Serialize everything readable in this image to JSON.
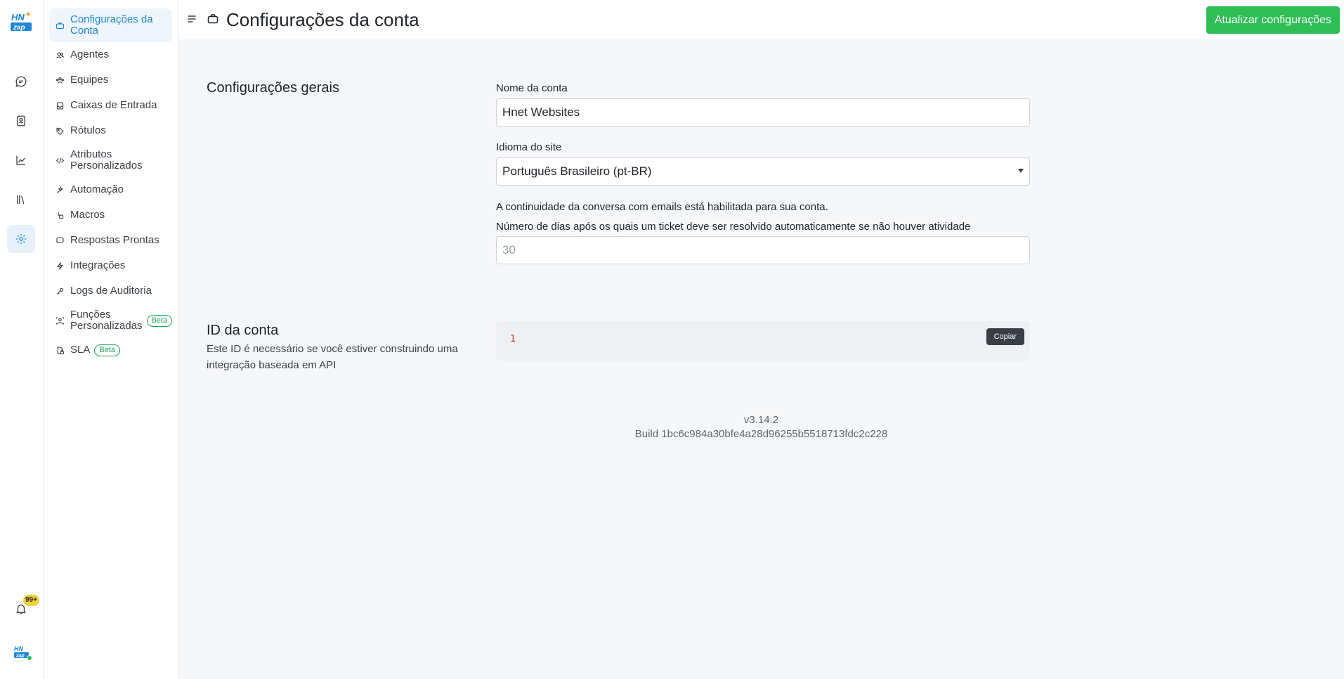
{
  "rail": {
    "items": [
      {
        "icon": "chat-icon"
      },
      {
        "icon": "contacts-icon"
      },
      {
        "icon": "reports-icon"
      },
      {
        "icon": "library-icon"
      },
      {
        "icon": "settings-icon",
        "active": true
      }
    ],
    "notifications_badge": "99+"
  },
  "sidebar": {
    "items": [
      {
        "label": "Configurações da Conta",
        "icon": "briefcase-icon",
        "active": true
      },
      {
        "label": "Agentes",
        "icon": "people-icon"
      },
      {
        "label": "Equipes",
        "icon": "team-icon"
      },
      {
        "label": "Caixas de Entrada",
        "icon": "inbox-icon"
      },
      {
        "label": "Rótulos",
        "icon": "tag-icon"
      },
      {
        "label": "Atributos Personalizados",
        "icon": "code-icon"
      },
      {
        "label": "Automação",
        "icon": "automation-icon"
      },
      {
        "label": "Macros",
        "icon": "macro-icon"
      },
      {
        "label": "Respostas Prontas",
        "icon": "chat-bubble-icon"
      },
      {
        "label": "Integrações",
        "icon": "flash-icon"
      },
      {
        "label": "Logs de Auditoria",
        "icon": "key-icon"
      },
      {
        "label": "Funções Personalizadas",
        "icon": "roles-icon",
        "badge": "Beta"
      },
      {
        "label": "SLA",
        "icon": "document-lock-icon",
        "badge": "Beta"
      }
    ]
  },
  "header": {
    "title": "Configurações da conta",
    "update_button": "Atualizar configurações"
  },
  "general": {
    "title": "Configurações gerais",
    "account_name_label": "Nome da conta",
    "account_name_value": "Hnet Websites",
    "language_label": "Idioma do site",
    "language_value": "Português Brasileiro (pt-BR)",
    "email_continuity_text": "A continuidade da conversa com emails está habilitada para sua conta.",
    "auto_resolve_label": "Número de dias após os quais um ticket deve ser resolvido automaticamente se não houver atividade",
    "auto_resolve_placeholder": "30"
  },
  "account_id": {
    "title": "ID da conta",
    "description": "Este ID é necessário se você estiver construindo uma integração baseada em API",
    "value": "1",
    "copy_button": "Copiar"
  },
  "footer": {
    "version": "v3.14.2",
    "build": "Build 1bc6c984a30bfe4a28d96255b5518713fdc2c228"
  },
  "colors": {
    "accent": "#1f86d8",
    "primary_button": "#2fbd56",
    "beta_badge": "#22a55a"
  }
}
